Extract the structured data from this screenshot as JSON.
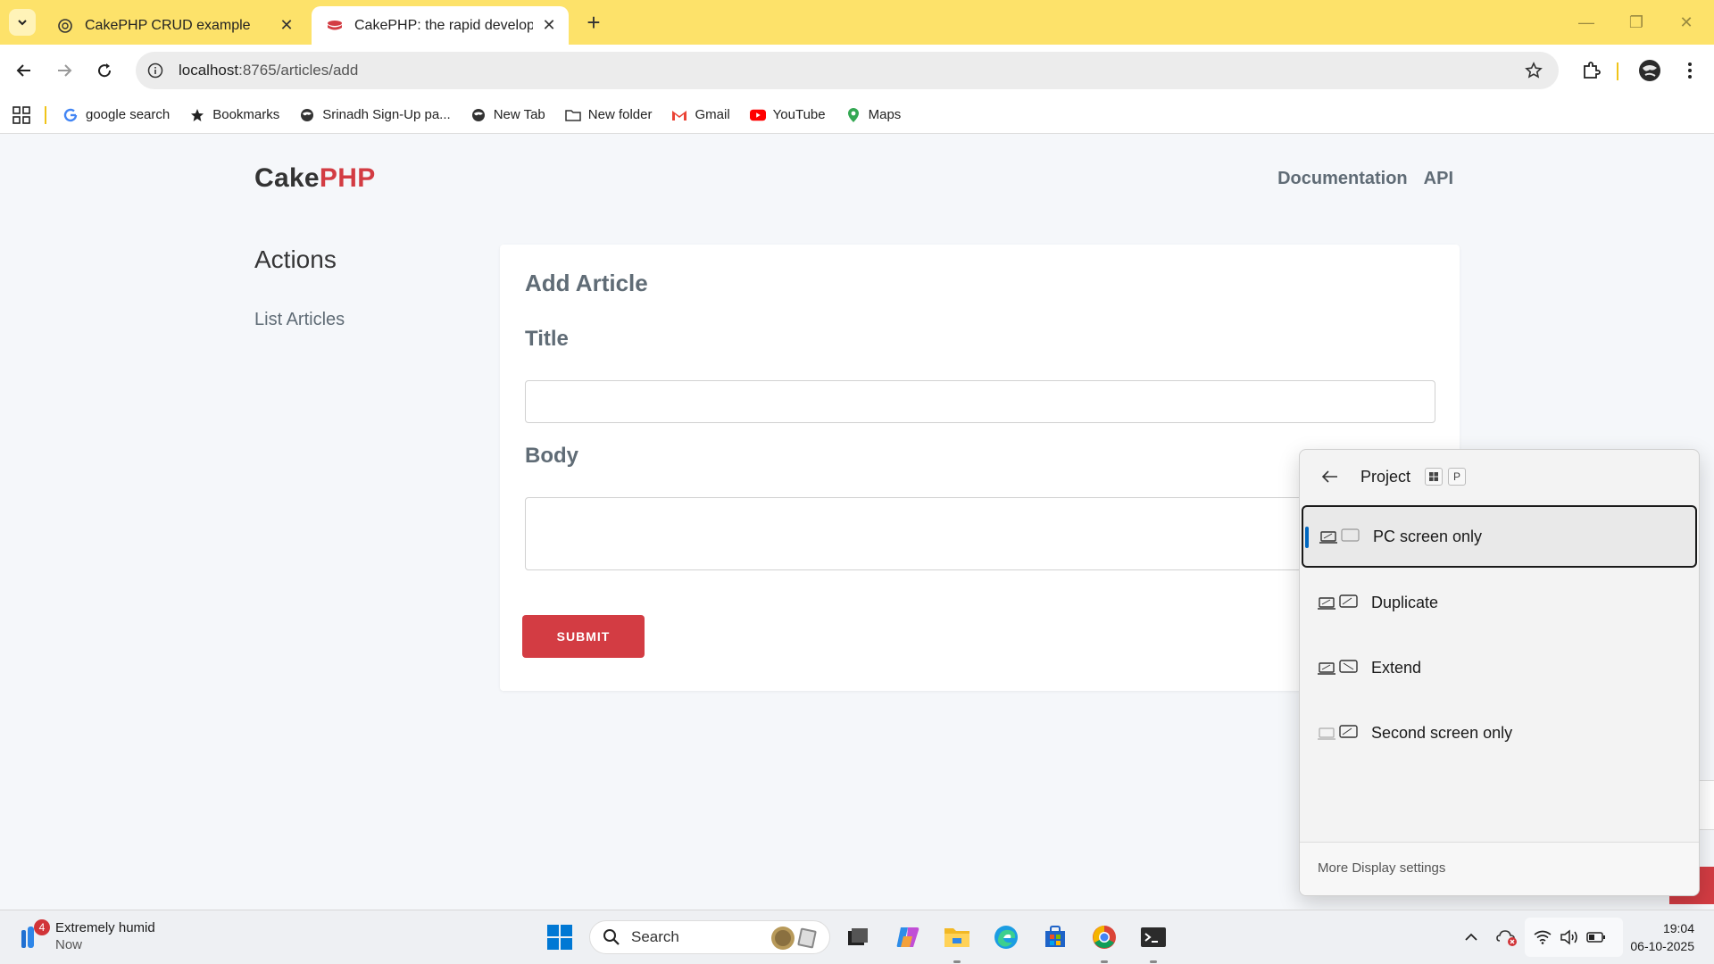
{
  "browser": {
    "tabs": [
      {
        "title": "CakePHP CRUD example",
        "active": false
      },
      {
        "title": "CakePHP: the rapid developme",
        "active": true
      }
    ],
    "url_host": "localhost",
    "url_path": ":8765/articles/add",
    "bookmarks": [
      {
        "label": "google search",
        "icon": "google-icon"
      },
      {
        "label": "Bookmarks",
        "icon": "star-icon"
      },
      {
        "label": "Srinadh Sign-Up pa...",
        "icon": "globe-icon"
      },
      {
        "label": "New Tab",
        "icon": "globe-icon"
      },
      {
        "label": "New folder",
        "icon": "folder-icon"
      },
      {
        "label": "Gmail",
        "icon": "gmail-icon"
      },
      {
        "label": "YouTube",
        "icon": "youtube-icon"
      },
      {
        "label": "Maps",
        "icon": "maps-icon"
      }
    ]
  },
  "page": {
    "logo_cake": "Cake",
    "logo_php": "PHP",
    "nav": [
      "Documentation",
      "API"
    ],
    "sidebar_heading": "Actions",
    "sidebar_link": "List Articles",
    "form": {
      "heading": "Add Article",
      "title_label": "Title",
      "title_value": "",
      "body_label": "Body",
      "body_value": "",
      "submit_label": "SUBMIT"
    }
  },
  "project_flyout": {
    "title": "Project",
    "shortcut_key": "P",
    "options": [
      {
        "label": "PC screen only",
        "selected": true
      },
      {
        "label": "Duplicate",
        "selected": false
      },
      {
        "label": "Extend",
        "selected": false
      },
      {
        "label": "Second screen only",
        "selected": false
      }
    ],
    "footer_link": "More Display settings"
  },
  "taskbar": {
    "weather_badge": "4",
    "weather_text": "Extremely humid",
    "weather_sub": "Now",
    "search_placeholder": "Search",
    "time": "19:04",
    "date": "06-10-2025"
  },
  "colors": {
    "tabstrip": "#fde26a",
    "brand_red": "#d33c43",
    "text_gray": "#606c76",
    "selection_blue": "#0067c0"
  }
}
